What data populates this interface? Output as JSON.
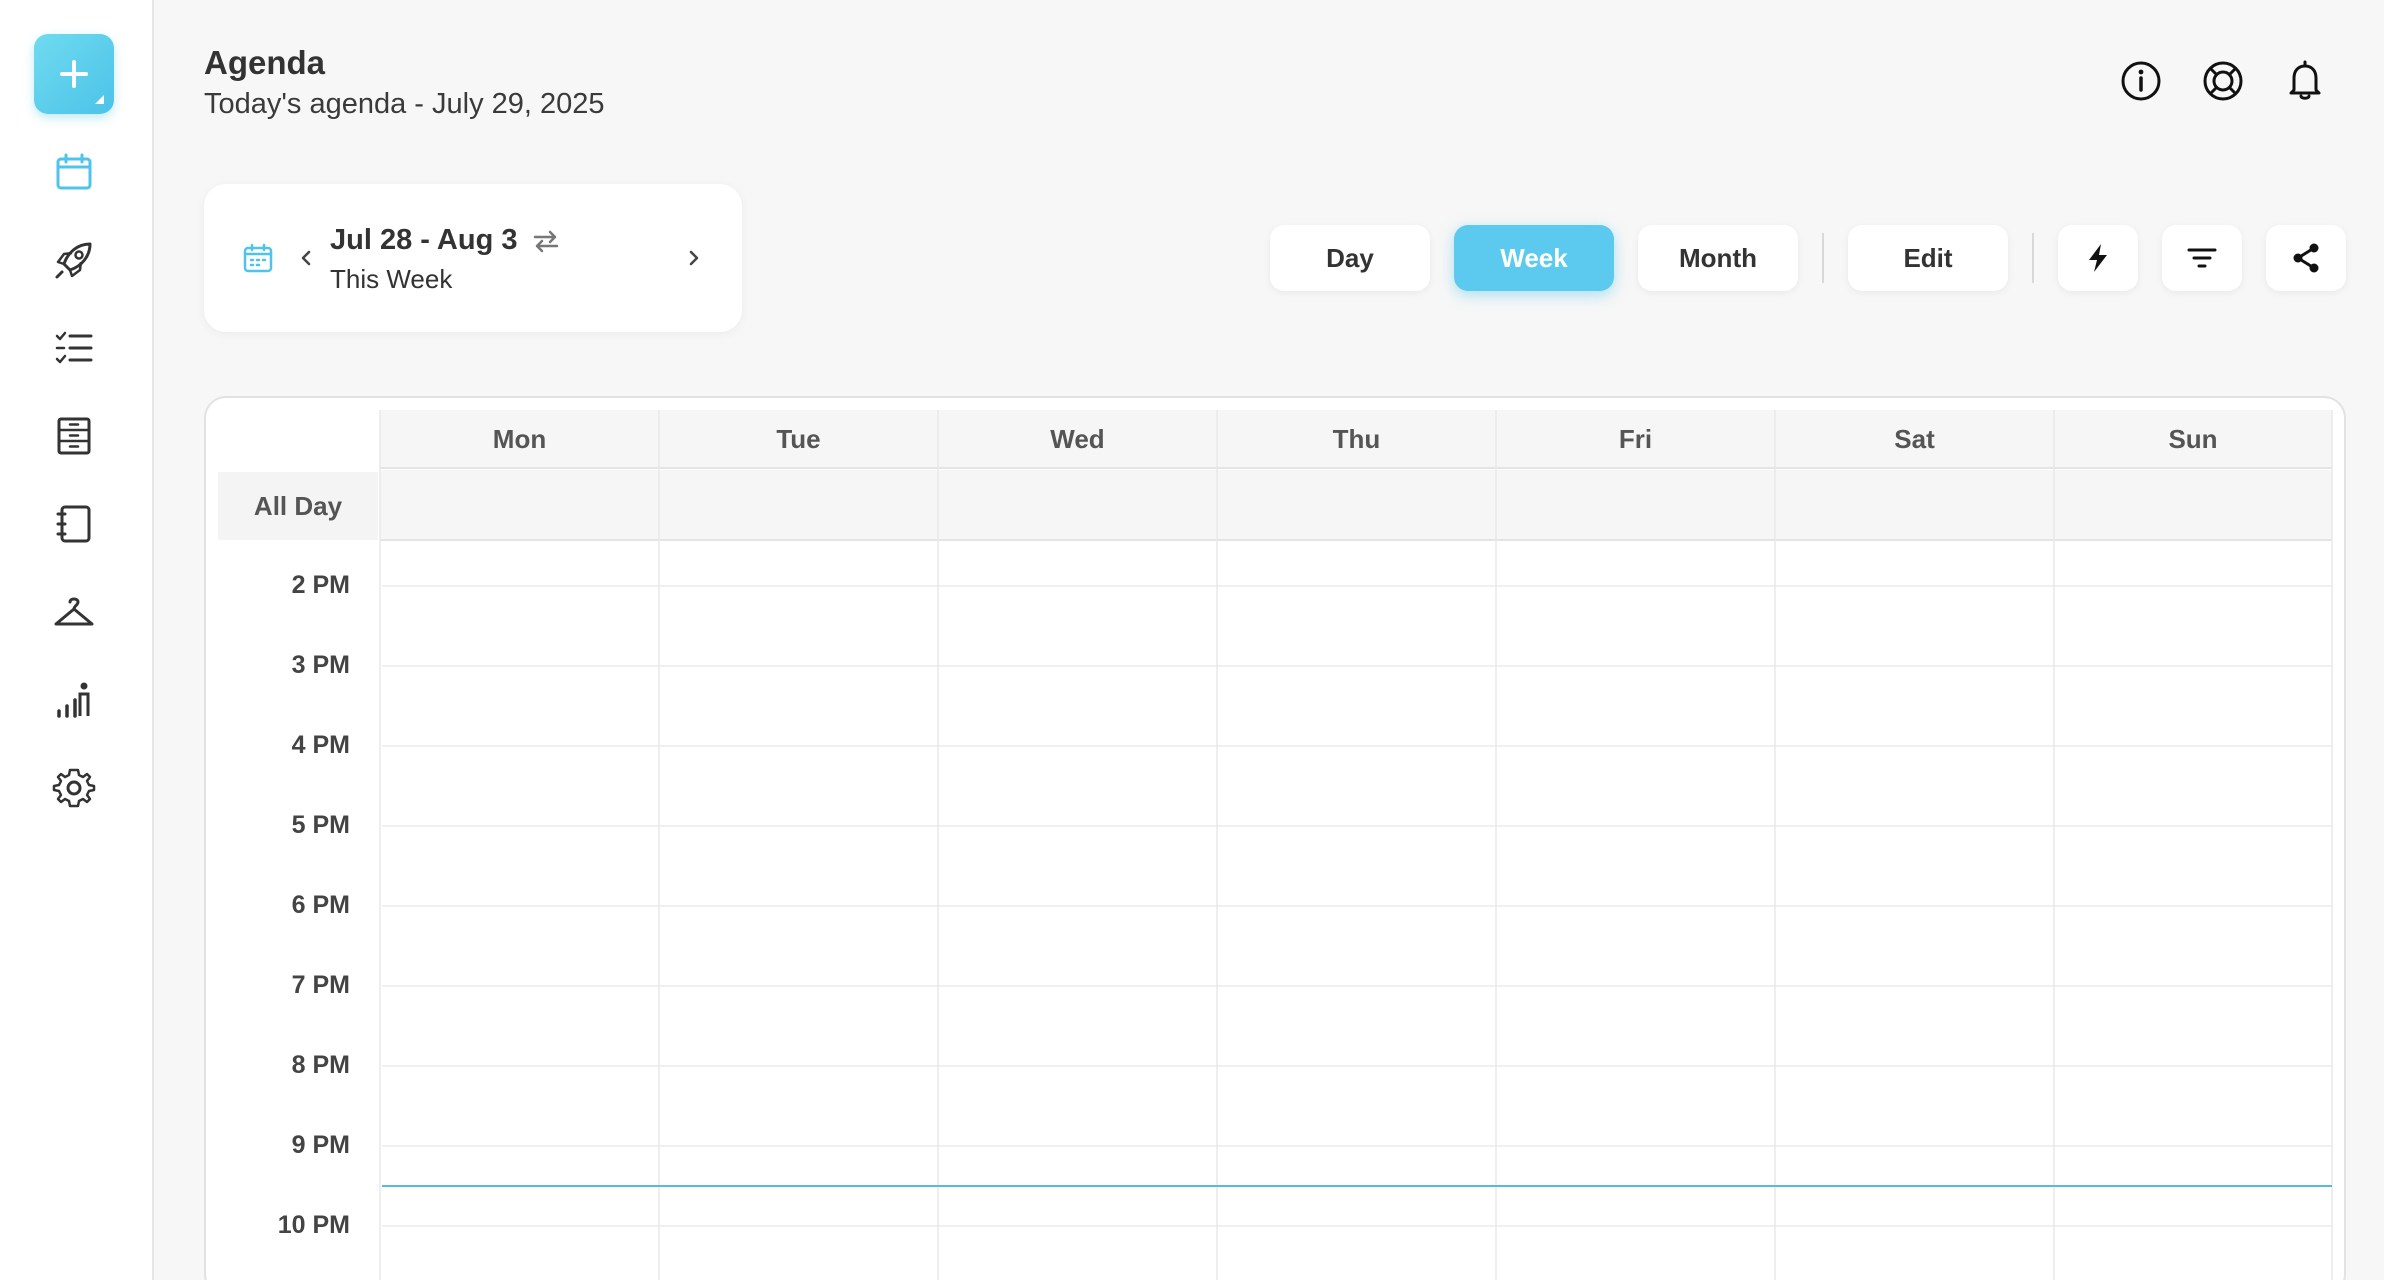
{
  "header": {
    "title": "Agenda",
    "subtitle": "Today's agenda - July 29, 2025"
  },
  "sidebar": {
    "add_icon": "plus-icon",
    "items": [
      {
        "name": "calendar",
        "icon": "calendar-icon",
        "active": true
      },
      {
        "name": "launch",
        "icon": "rocket-icon"
      },
      {
        "name": "tasks",
        "icon": "checklist-icon"
      },
      {
        "name": "storage",
        "icon": "cabinet-icon"
      },
      {
        "name": "notebook",
        "icon": "notebook-icon"
      },
      {
        "name": "wardrobe",
        "icon": "hanger-icon"
      },
      {
        "name": "progress",
        "icon": "growth-chart-icon"
      },
      {
        "name": "settings",
        "icon": "gear-icon"
      }
    ]
  },
  "top_icons": [
    "info-icon",
    "lifebuoy-icon",
    "bell-icon"
  ],
  "range": {
    "title": "Jul 28 - Aug 3",
    "subtitle": "This Week"
  },
  "toolbar": {
    "views": [
      "Day",
      "Week",
      "Month"
    ],
    "active_view": "Week",
    "edit_label": "Edit",
    "icons": [
      "lightning-icon",
      "filter-icon",
      "share-icon"
    ]
  },
  "calendar": {
    "days": [
      "Mon",
      "Tue",
      "Wed",
      "Thu",
      "Fri",
      "Sat",
      "Sun"
    ],
    "all_day_label": "All Day",
    "hours": [
      "2 PM",
      "3 PM",
      "4 PM",
      "5 PM",
      "6 PM",
      "7 PM",
      "8 PM",
      "9 PM",
      "10 PM"
    ],
    "now_time": "9:30 PM"
  },
  "colors": {
    "accent": "#5ccaee",
    "now_line": "#5ab8e0"
  }
}
